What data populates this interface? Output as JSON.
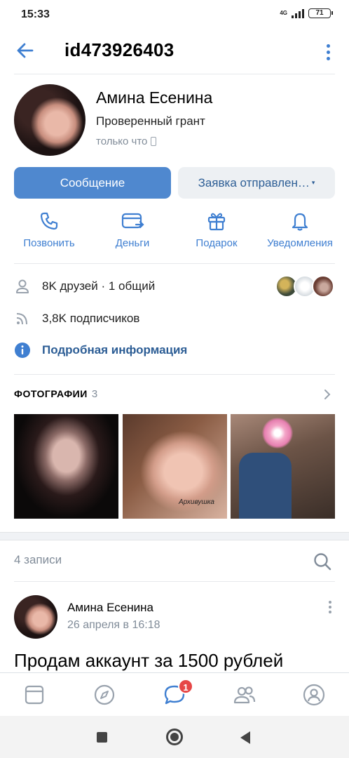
{
  "status_bar": {
    "time": "15:33",
    "network": "4G",
    "battery": "71"
  },
  "header": {
    "title": "id473926403"
  },
  "profile": {
    "name": "Амина Есенина",
    "status": "Проверенный грант",
    "online": "только что"
  },
  "buttons": {
    "message": "Сообщение",
    "request": "Заявка отправлен…"
  },
  "actions": [
    {
      "label": "Позвонить",
      "icon": "phone-icon"
    },
    {
      "label": "Деньги",
      "icon": "money-transfer-icon"
    },
    {
      "label": "Подарок",
      "icon": "gift-icon"
    },
    {
      "label": "Уведомления",
      "icon": "bell-icon"
    }
  ],
  "info": {
    "friends": "8K друзей · 1 общий",
    "subscribers": "3,8K подписчиков",
    "details_link": "Подробная информация"
  },
  "photos": {
    "title": "ФОТОГРАФИИ",
    "count": "3",
    "watermark": "Архивушка"
  },
  "posts": {
    "count_label": "4 записи",
    "items": [
      {
        "author": "Амина Есенина",
        "date": "26 апреля в 16:18",
        "text": "Продам аккаунт за 1500 рублей"
      }
    ]
  },
  "tabbar": {
    "tabs": [
      "news-tab",
      "discover-tab",
      "messages-tab",
      "friends-tab",
      "profile-tab"
    ],
    "messages_badge": "1"
  },
  "colors": {
    "accent": "#4f88cf",
    "link": "#2c5d95",
    "badge": "#e64646",
    "muted": "#818c99"
  }
}
